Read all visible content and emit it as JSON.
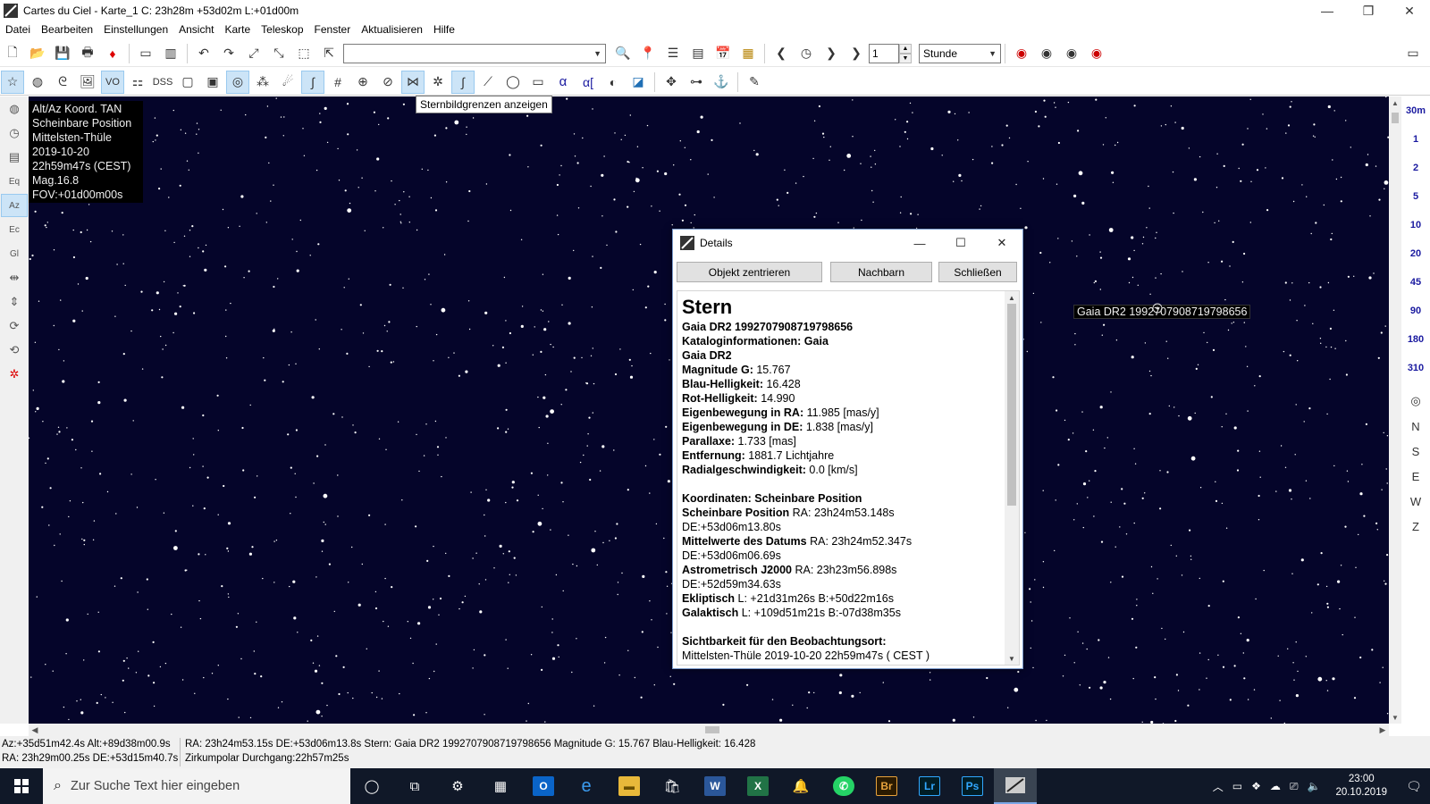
{
  "window": {
    "title": "Cartes du Ciel - Karte_1  C: 23h28m +53d02m L:+01d00m",
    "minimize": "—",
    "maximize": "❐",
    "close": "✕"
  },
  "menu": [
    "Datei",
    "Bearbeiten",
    "Einstellungen",
    "Ansicht",
    "Karte",
    "Teleskop",
    "Fenster",
    "Aktualisieren",
    "Hilfe"
  ],
  "toolbar": {
    "search_value": "",
    "step_value": "1",
    "time_unit": "Stunde",
    "vo_label": "VO",
    "dss_label": "DSS",
    "alpha_label": "α",
    "alpha2_label": "α[",
    "tooltip": "Sternbildgrenzen anzeigen"
  },
  "leftstrip": {
    "eq_label": "Eq",
    "az_label": "Az",
    "ec_label": "Ec",
    "gl_label": "Gl"
  },
  "chart_info": {
    "lines": [
      "Alt/Az Koord. TAN",
      "Scheinbare Position",
      "Mittelsten-Thüle",
      "2019-10-20",
      "22h59m47s (CEST)",
      "Mag.16.8",
      "FOV:+01d00m00s"
    ]
  },
  "star_label": "Gaia DR2 1992707908719798656",
  "fov_scale": [
    "30m",
    "1",
    "2",
    "5",
    "10",
    "20",
    "45",
    "90",
    "180",
    "310"
  ],
  "directions": [
    "N",
    "S",
    "E",
    "W",
    "Z"
  ],
  "details": {
    "title": "Details",
    "buttons": {
      "center": "Objekt zentrieren",
      "neighbors": "Nachbarn",
      "close": "Schließen"
    },
    "heading": "Stern",
    "rows": [
      {
        "label": "Gaia DR2 1992707908719798656",
        "value": ""
      },
      {
        "label": "Kataloginformationen: Gaia",
        "value": ""
      },
      {
        "label": "Gaia DR2",
        "value": ""
      },
      {
        "label": "Magnitude G:",
        "value": " 15.767"
      },
      {
        "label": "Blau-Helligkeit:",
        "value": " 16.428"
      },
      {
        "label": "Rot-Helligkeit:",
        "value": " 14.990"
      },
      {
        "label": "Eigenbewegung in RA:",
        "value": " 11.985 [mas/y]"
      },
      {
        "label": "Eigenbewegung in DE:",
        "value": " 1.838 [mas/y]"
      },
      {
        "label": "Parallaxe:",
        "value": " 1.733 [mas]"
      },
      {
        "label": "Entfernung:",
        "value": " 1881.7 Lichtjahre"
      },
      {
        "label": "Radialgeschwindigkeit:",
        "value": " 0.0 [km/s]"
      }
    ],
    "coords_heading": "Koordinaten: Scheinbare Position",
    "coords": [
      {
        "label": "Scheinbare Position",
        "value": " RA: 23h24m53.148s",
        "line2": "DE:+53d06m13.80s"
      },
      {
        "label": "Mittelwerte des Datums",
        "value": " RA: 23h24m52.347s",
        "line2": "DE:+53d06m06.69s"
      },
      {
        "label": "Astrometrisch J2000",
        "value": " RA: 23h23m56.898s",
        "line2": "DE:+52d59m34.63s"
      },
      {
        "label": "Ekliptisch",
        "value": "  L: +21d31m26s B:+50d22m16s",
        "line2": ""
      },
      {
        "label": "Galaktisch",
        "value": "  L: +109d51m21s B:-07d38m35s",
        "line2": ""
      }
    ],
    "visibility_heading": "Sichtbarkeit für den Beobachtungsort:",
    "visibility_line": "Mittelsten-Thüle 2019-10-20 22h59m47s ( CEST )"
  },
  "status": {
    "left1": "Az:+35d51m42.4s Alt:+89d38m00.9s",
    "left2": "RA: 23h29m00.25s DE:+53d15m40.7s",
    "right1": "RA: 23h24m53.15s DE:+53d06m13.8s  Stern: Gaia DR2 1992707908719798656  Magnitude G: 15.767  Blau-Helligkeit: 16.428",
    "right2": "Zirkumpolar  Durchgang:22h57m25s"
  },
  "taskbar": {
    "search_placeholder": "Zur Suche Text hier eingeben",
    "word": "W",
    "excel": "X",
    "bridge": "Br",
    "lightroom": "Lr",
    "photoshop": "Ps",
    "time": "23:00",
    "date": "20.10.2019"
  },
  "colors": {
    "sky": "#05052a",
    "star": "#ffffff",
    "fov_label": "#1a1aa0",
    "taskbar": "#101828"
  }
}
